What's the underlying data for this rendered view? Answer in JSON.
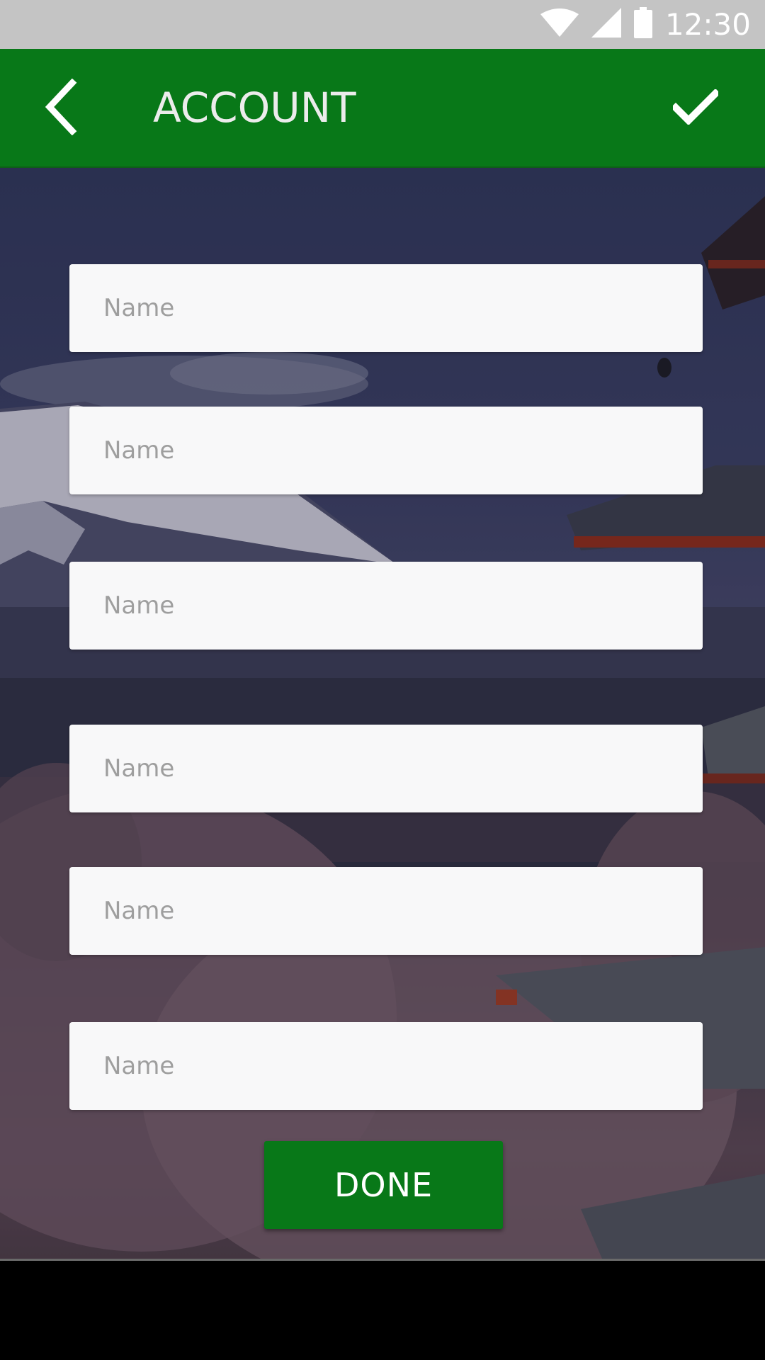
{
  "status_bar": {
    "time": "12:30",
    "icons": [
      "wifi-icon",
      "signal-icon",
      "battery-icon"
    ]
  },
  "app_bar": {
    "title": "ACCOUNT",
    "back_icon": "chevron-left-icon",
    "confirm_icon": "check-icon",
    "background_color": "#087818"
  },
  "form": {
    "fields": [
      {
        "placeholder": "Name",
        "value": ""
      },
      {
        "placeholder": "Name",
        "value": ""
      },
      {
        "placeholder": "Name",
        "value": ""
      },
      {
        "placeholder": "Name",
        "value": ""
      },
      {
        "placeholder": "Name",
        "value": ""
      },
      {
        "placeholder": "Name",
        "value": ""
      }
    ],
    "submit_label": "DONE",
    "submit_color": "#087818"
  },
  "background": {
    "description_icon": "landscape-photo"
  }
}
